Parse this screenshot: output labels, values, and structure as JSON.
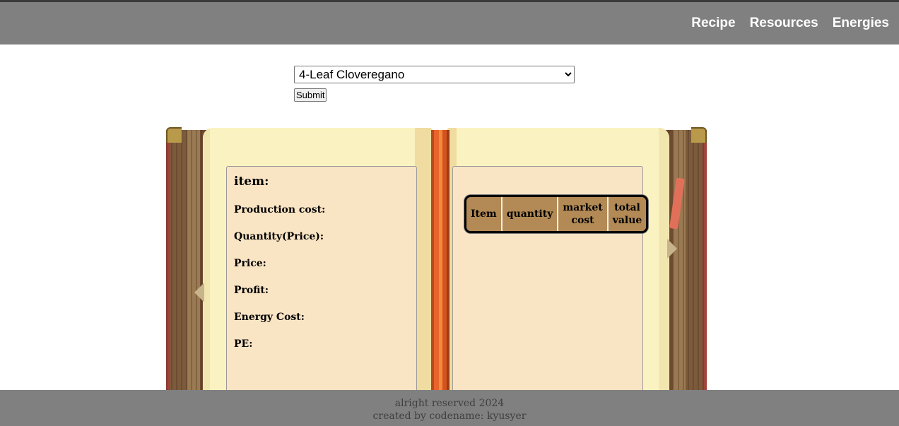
{
  "nav": {
    "links": [
      "Recipe",
      "Resources",
      "Energies"
    ]
  },
  "form": {
    "selected_recipe": "4-Leaf Cloveregano",
    "submit_label": "Submit"
  },
  "left_page": {
    "item_label": "item:",
    "production_cost_label": "Production cost:",
    "quantity_price_label": "Quantity(Price):",
    "price_label": "Price:",
    "profit_label": "Profit:",
    "energy_cost_label": "Energy Cost:",
    "pe_label": "PE:"
  },
  "right_page": {
    "table_headers": [
      "Item",
      "quantity",
      "market cost",
      "total value"
    ]
  },
  "footer": {
    "line1": "alright reserved 2024",
    "line2": "created by codename: kyusyer"
  }
}
